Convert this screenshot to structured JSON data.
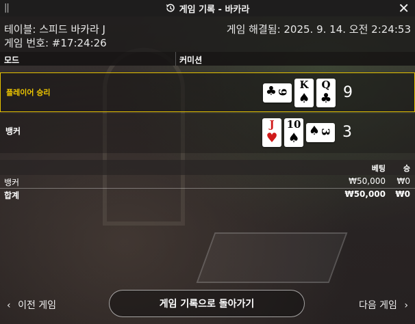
{
  "header": {
    "handle": "||",
    "title": "게임 기록 - 바카라",
    "history_icon": "history-icon",
    "close_icon": "close-icon",
    "close_glyph": "✕"
  },
  "info": {
    "table": "테이블: 스피드 바카라 J",
    "game_number": "게임 번호: #17:24:26",
    "resolved": "게임 해결됨: 2025. 9. 14. 오전 2:24:53"
  },
  "mode": {
    "col1": "모드",
    "col2": "커미션"
  },
  "results": {
    "player": {
      "label": "플레이어 승리",
      "score": "9",
      "cards": [
        {
          "rank": "9",
          "suit": "♣",
          "color": "#000000",
          "orientation": "sideways"
        },
        {
          "rank": "K",
          "suit": "♠",
          "color": "#000000",
          "orientation": "upright"
        },
        {
          "rank": "Q",
          "suit": "♣",
          "color": "#000000",
          "orientation": "upright"
        }
      ]
    },
    "banker": {
      "label": "뱅커",
      "score": "3",
      "cards": [
        {
          "rank": "J",
          "suit": "♥",
          "color": "#d01a1a",
          "orientation": "upright"
        },
        {
          "rank": "10",
          "suit": "♠",
          "color": "#000000",
          "orientation": "upright"
        },
        {
          "rank": "3",
          "suit": "♠",
          "color": "#000000",
          "orientation": "sideways"
        }
      ]
    }
  },
  "bets": {
    "headers": {
      "bet": "베팅",
      "win": "승"
    },
    "rows": [
      {
        "name": "뱅커",
        "bet": "₩50,000",
        "win": "₩0"
      },
      {
        "name": "합계",
        "bet": "₩50,000",
        "win": "₩0"
      }
    ]
  },
  "footer": {
    "prev": "이전 게임",
    "prev_glyph": "‹",
    "back": "게임 기록으로 돌아가기",
    "next": "다음 게임",
    "next_glyph": "›"
  },
  "colors": {
    "winner_accent": "#e6c200",
    "header_bg": "#1e1d1d"
  }
}
